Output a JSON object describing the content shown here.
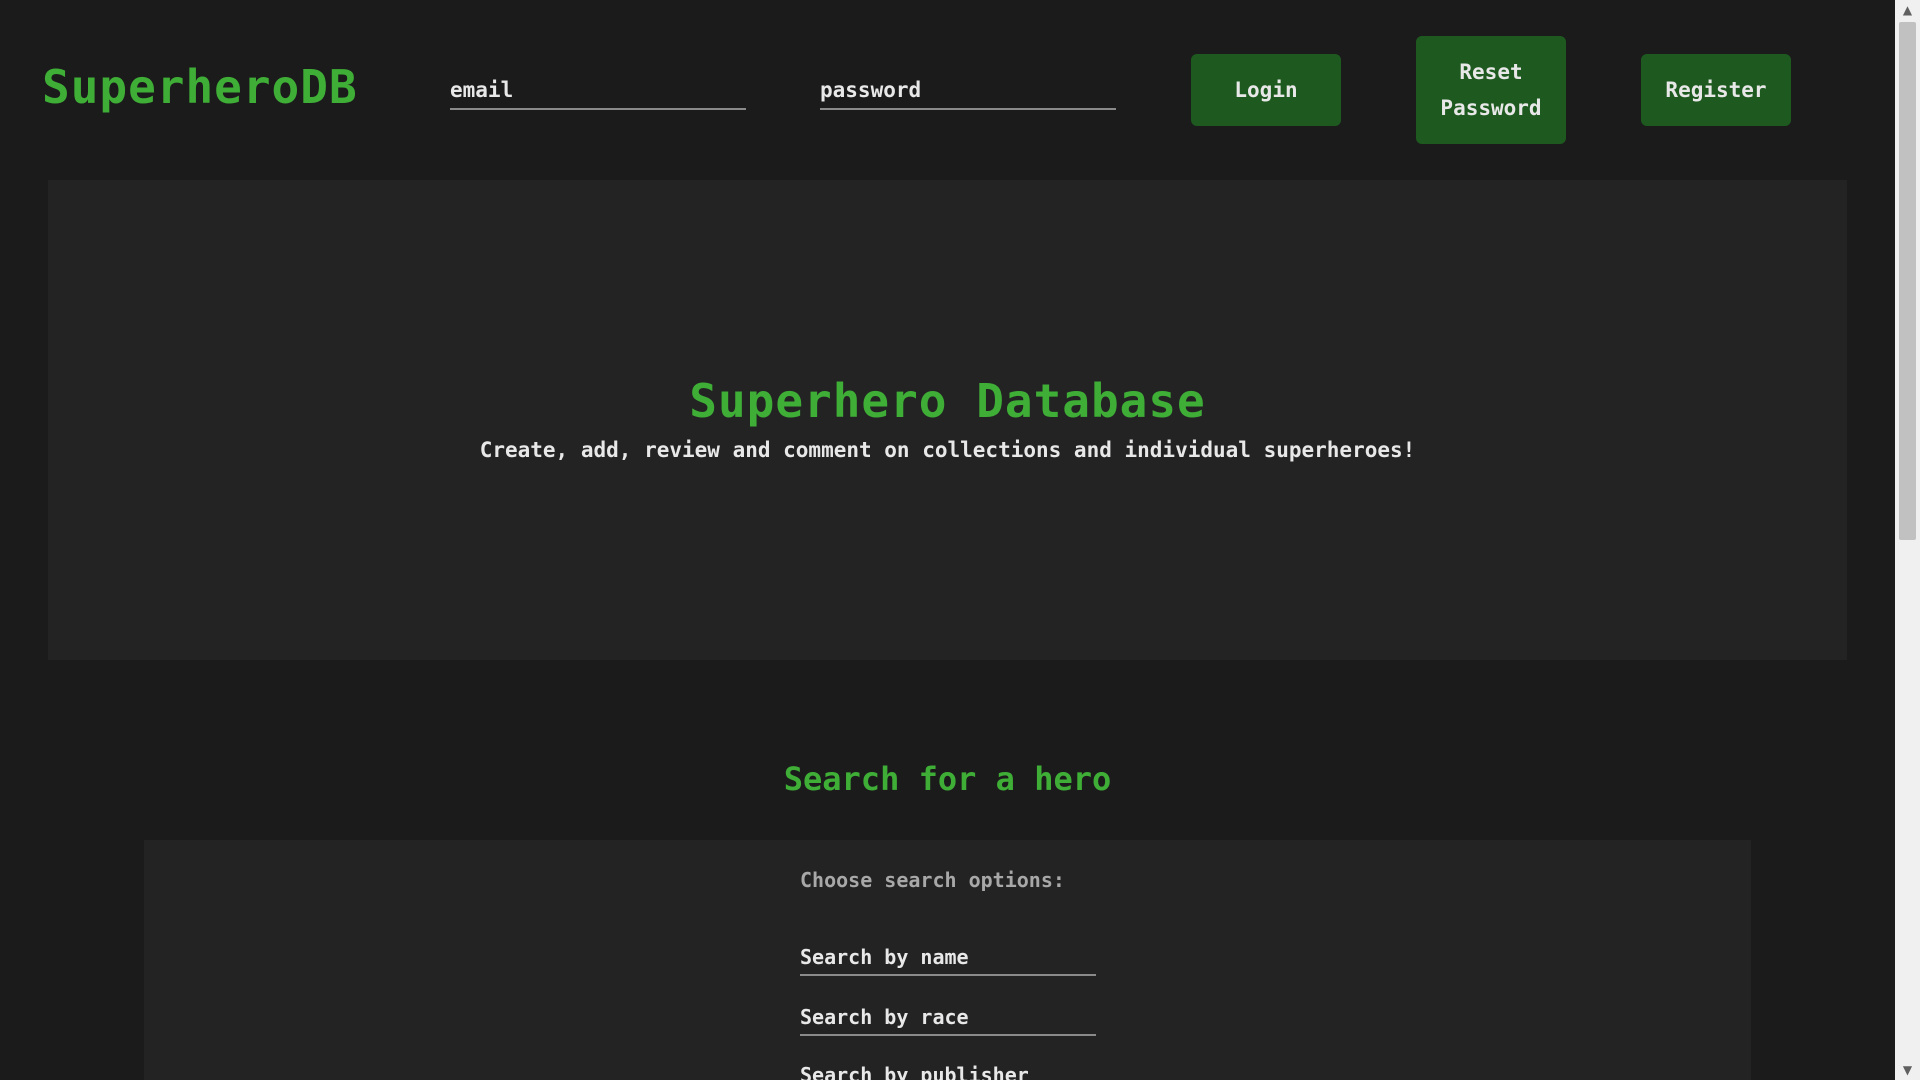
{
  "header": {
    "logo": "SuperheroDB",
    "email_placeholder": "email",
    "password_placeholder": "password",
    "login_label": "Login",
    "reset_label_line1": "Reset",
    "reset_label_line2": "Password",
    "register_label": "Register"
  },
  "hero": {
    "title": "Superhero Database",
    "subtitle": "Create, add, review and comment on collections and individual superheroes!"
  },
  "search": {
    "heading": "Search for a hero",
    "options_label": "Choose search options:",
    "name_placeholder": "Search by name",
    "race_placeholder": "Search by race",
    "publisher_placeholder": "Search by publisher"
  },
  "scrollbar": {
    "up_icon": "chevron-up-icon",
    "down_icon": "chevron-down-icon"
  },
  "colors": {
    "background": "#1b1b1c",
    "panel": "#232324",
    "accent_green": "#3fae36",
    "button_green": "#1e5a1f",
    "text": "#e8e8e8"
  }
}
